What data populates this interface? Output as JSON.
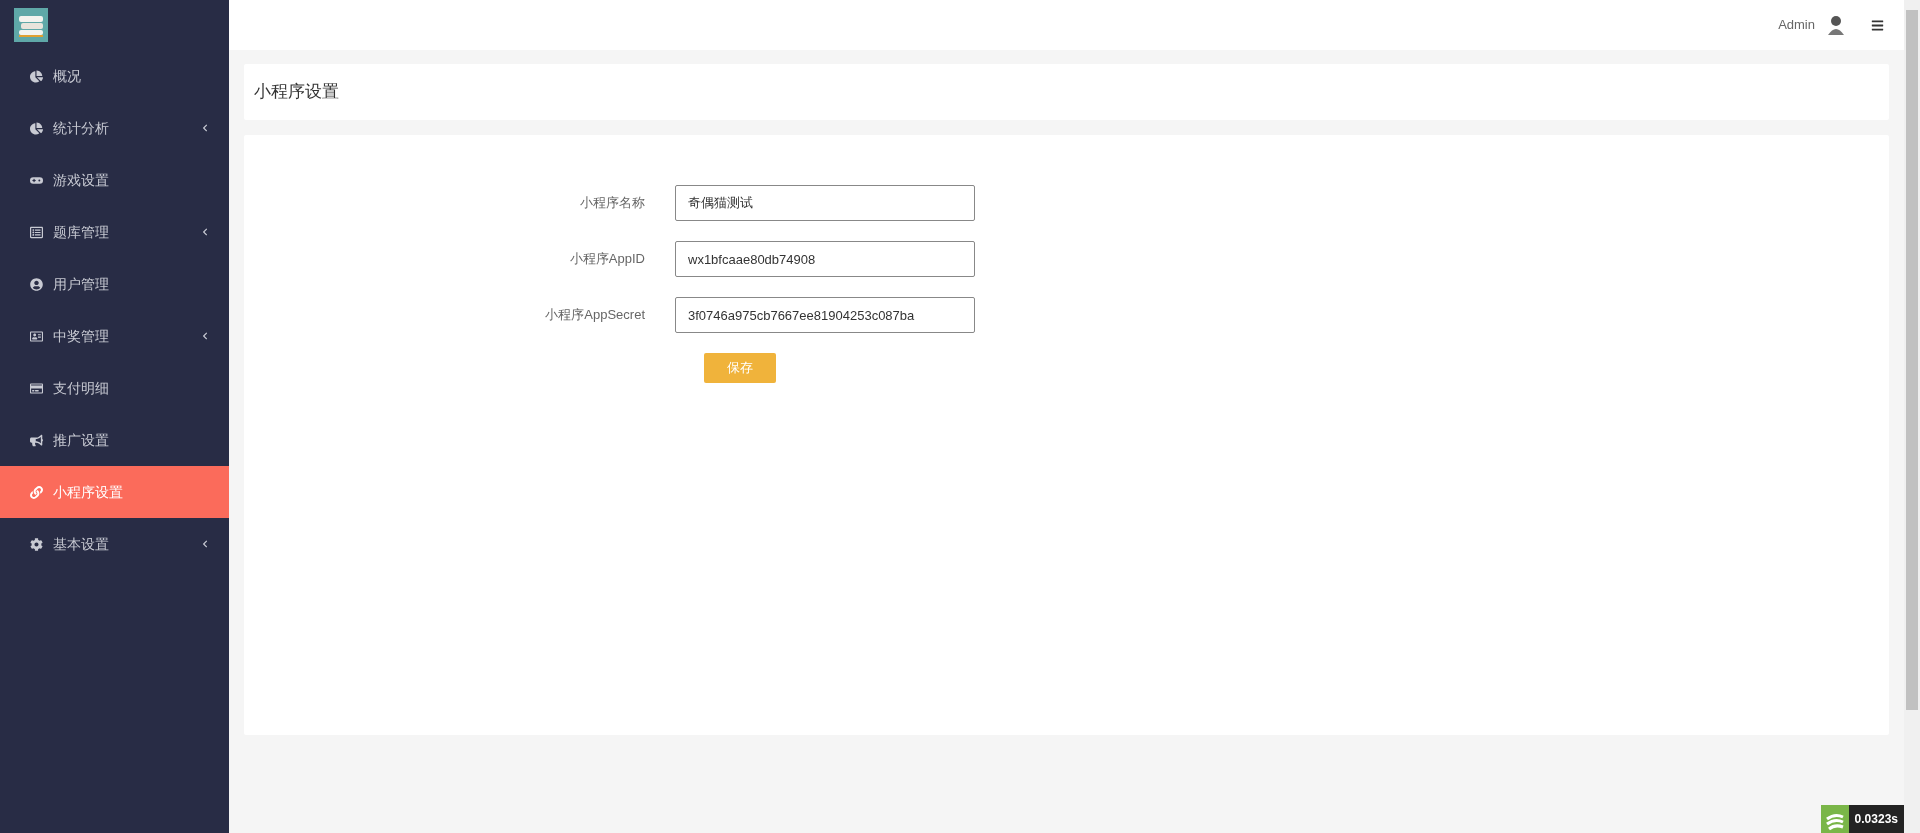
{
  "sidebar": {
    "items": [
      {
        "label": "概况",
        "has_submenu": false,
        "selected": false
      },
      {
        "label": "统计分析",
        "has_submenu": true,
        "selected": false
      },
      {
        "label": "游戏设置",
        "has_submenu": false,
        "selected": false
      },
      {
        "label": "题库管理",
        "has_submenu": true,
        "selected": false
      },
      {
        "label": "用户管理",
        "has_submenu": false,
        "selected": false
      },
      {
        "label": "中奖管理",
        "has_submenu": true,
        "selected": false
      },
      {
        "label": "支付明细",
        "has_submenu": false,
        "selected": false
      },
      {
        "label": "推广设置",
        "has_submenu": false,
        "selected": false
      },
      {
        "label": "小程序设置",
        "has_submenu": false,
        "selected": true
      },
      {
        "label": "基本设置",
        "has_submenu": true,
        "selected": false
      }
    ]
  },
  "topbar": {
    "user": "Admin"
  },
  "page": {
    "title": "小程序设置"
  },
  "form": {
    "fields": [
      {
        "label": "小程序名称",
        "value": "奇偶猫测试"
      },
      {
        "label": "小程序AppID",
        "value": "wx1bfcaae80db74908"
      },
      {
        "label": "小程序AppSecret",
        "value": "3f0746a975cb7667ee81904253c087ba"
      }
    ],
    "submit": "保存"
  },
  "trace": {
    "time": "0.0323s"
  }
}
